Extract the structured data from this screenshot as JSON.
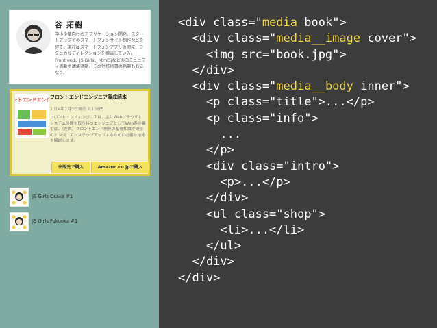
{
  "colors": {
    "left_panel_bg": "#7faba3",
    "code_bg": "#3c3c3c",
    "code_text": "#ffffff",
    "code_highlight": "#f1d63d",
    "book_border": "#dfc93b",
    "book_bg": "#f2f0c8",
    "button_bg": "#f3e35c"
  },
  "profile": {
    "name": "谷 拓樹",
    "bio": "中小企業向けのアプリケーション開発、スタートアップでのスマートフォンサイト制作などを経て、現在はスマートフォンアプリの開発、テクニカルディレクションを担当している。Frontrend、JS Girls、html5jなどのコミュニティ活動や講演活動、その他技術書の執筆もおこなう。"
  },
  "book": {
    "title": "フロントエンドエンジニア養成読本",
    "info": "2014年7月3日発売 2,138円",
    "intro": "フロントエンドエンジニアは、主にWebブラウザとシステムの間を取り持つエンジニアとしてWeb系企業では、（左右）フロントエンド開発の基礎知識や現役のエンジニアがステップアップするために必要な技術を解説します。",
    "cover_text": "フロントエンドエンジニア",
    "shop_buttons": [
      "出版元で購入",
      "Amazon.co.jpで購入"
    ]
  },
  "events": [
    {
      "label": "JS Girls Osaka #1"
    },
    {
      "label": "JS Girls Fukuoka #1"
    }
  ],
  "code_lines": [
    {
      "parts": [
        {
          "t": "<div class=\""
        },
        {
          "t": "media",
          "hl": true
        },
        {
          "t": " book\">"
        }
      ]
    },
    {
      "parts": [
        {
          "t": "  <div class=\""
        },
        {
          "t": "media__image",
          "hl": true
        },
        {
          "t": " cover\">"
        }
      ]
    },
    {
      "parts": [
        {
          "t": "    <img src=\"book.jpg\">"
        }
      ]
    },
    {
      "parts": [
        {
          "t": "  </div>"
        }
      ]
    },
    {
      "parts": [
        {
          "t": "  <div class=\""
        },
        {
          "t": "media__body",
          "hl": true
        },
        {
          "t": " inner\">"
        }
      ]
    },
    {
      "parts": [
        {
          "t": "    <p class=\"title\">...</p>"
        }
      ]
    },
    {
      "parts": [
        {
          "t": "    <p class=\"info\">"
        }
      ]
    },
    {
      "parts": [
        {
          "t": "      ..."
        }
      ]
    },
    {
      "parts": [
        {
          "t": "    </p>"
        }
      ]
    },
    {
      "parts": [
        {
          "t": "    <div class=\"intro\">"
        }
      ]
    },
    {
      "parts": [
        {
          "t": "      <p>...</p>"
        }
      ]
    },
    {
      "parts": [
        {
          "t": "    </div>"
        }
      ]
    },
    {
      "parts": [
        {
          "t": "    <ul class=\"shop\">"
        }
      ]
    },
    {
      "parts": [
        {
          "t": "      <li>...</li>"
        }
      ]
    },
    {
      "parts": [
        {
          "t": "    </ul>"
        }
      ]
    },
    {
      "parts": [
        {
          "t": "  </div>"
        }
      ]
    },
    {
      "parts": [
        {
          "t": "</div>"
        }
      ]
    }
  ]
}
